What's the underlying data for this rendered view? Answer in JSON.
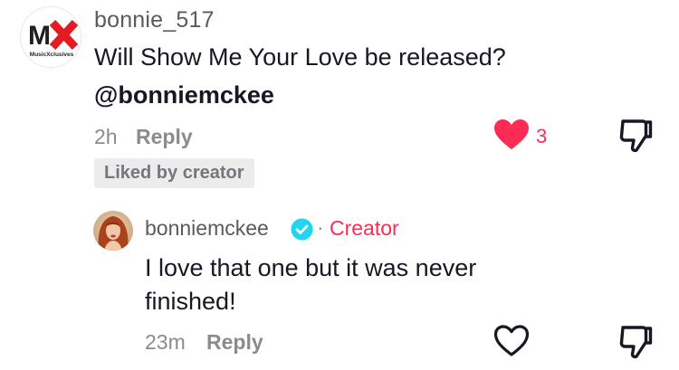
{
  "comment": {
    "username": "bonnie_517",
    "avatar_logo": "MX",
    "avatar_subtext": "MusicXclusives",
    "text_line1": "Will Show Me Your Love be released?",
    "mention": "@bonniemckee",
    "time": "2h",
    "reply_label": "Reply",
    "like_count": "3",
    "liked_badge": "Liked by creator",
    "liked": true
  },
  "reply": {
    "username": "bonniemckee",
    "separator": "·",
    "role_label": "Creator",
    "text_line1": "I love that one but it was never",
    "text_line2": "finished!",
    "time": "23m",
    "reply_label": "Reply",
    "liked": false
  },
  "colors": {
    "accent": "#fe2c55",
    "verified": "#20d5ec",
    "muted": "#8a8b91",
    "text": "#161823",
    "badge_bg": "#ececec"
  },
  "icons": [
    "heart-filled-icon",
    "heart-outline-icon",
    "dislike-icon",
    "verified-badge-icon"
  ]
}
